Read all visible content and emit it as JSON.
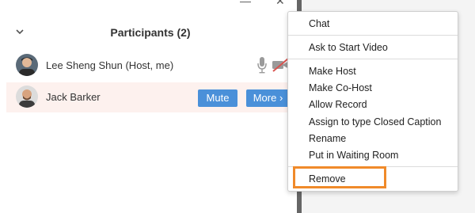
{
  "window": {
    "minimize_glyph": "—",
    "close_glyph": "✕"
  },
  "panel": {
    "title": "Participants (2)",
    "collapse_icon": "chevron-down-icon"
  },
  "participants": [
    {
      "name": "Lee Sheng Shun (Host, me)",
      "mic": "mic-icon",
      "camera": "video-off-icon"
    },
    {
      "name": "Jack Barker",
      "mute_label": "Mute",
      "more_label": "More ›"
    }
  ],
  "context_menu": {
    "items": [
      "Chat",
      "Ask to Start Video",
      "Make Host",
      "Make Co-Host",
      "Allow Record",
      "Assign to type Closed Caption",
      "Rename",
      "Put in Waiting Room",
      "Remove"
    ]
  },
  "colors": {
    "accent": "#4a90d9",
    "highlight": "#f08a2a",
    "row_hover": "#fdf1ee",
    "muted_slash": "#d9534f"
  }
}
